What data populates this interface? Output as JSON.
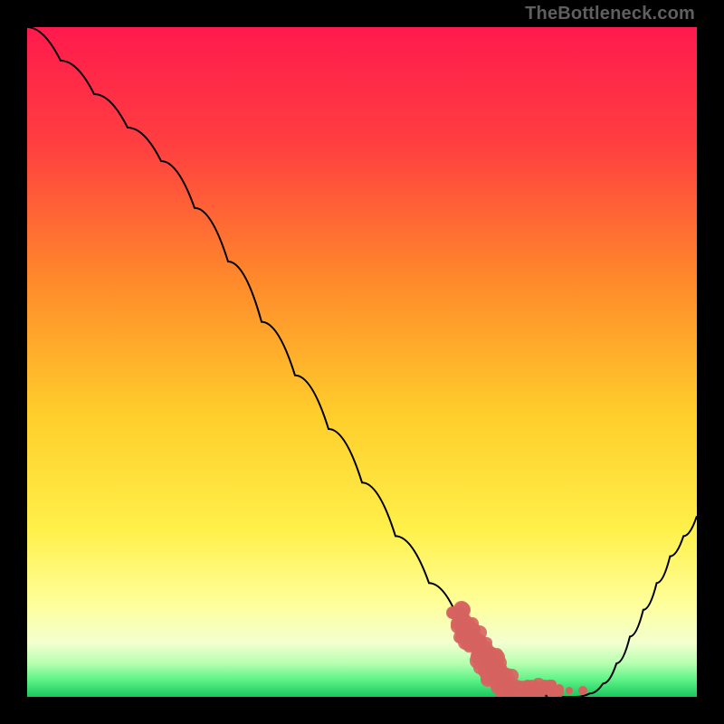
{
  "watermark": "TheBottleneck.com",
  "colors": {
    "curve": "#000000",
    "dots": "#d6635f",
    "gradient_top": "#ff1a4d",
    "gradient_mid1": "#ff7a33",
    "gradient_mid2": "#ffe346",
    "gradient_light": "#ffffaa",
    "gradient_bottom": "#1fd86a"
  },
  "chart_data": {
    "type": "line",
    "title": "",
    "xlabel": "",
    "ylabel": "",
    "xlim": [
      0,
      100
    ],
    "ylim": [
      0,
      100
    ],
    "series": [
      {
        "name": "curve",
        "x": [
          0,
          5,
          10,
          15,
          20,
          25,
          30,
          35,
          40,
          45,
          50,
          55,
          60,
          65,
          68,
          70,
          72,
          74,
          76,
          78,
          80,
          82,
          84,
          86,
          88,
          90,
          92,
          94,
          96,
          98,
          100
        ],
        "values": [
          100,
          95,
          90,
          85,
          80,
          73,
          65,
          56,
          48,
          40,
          32,
          24,
          17,
          10,
          6,
          3,
          1.5,
          0.7,
          0.3,
          0.1,
          0,
          0,
          0.5,
          2,
          5,
          9,
          13,
          17,
          21,
          24,
          27
        ]
      }
    ],
    "scatter_overlay": {
      "name": "highlight-dots",
      "x_range": [
        64,
        80
      ],
      "y_range": [
        0,
        12
      ]
    }
  }
}
